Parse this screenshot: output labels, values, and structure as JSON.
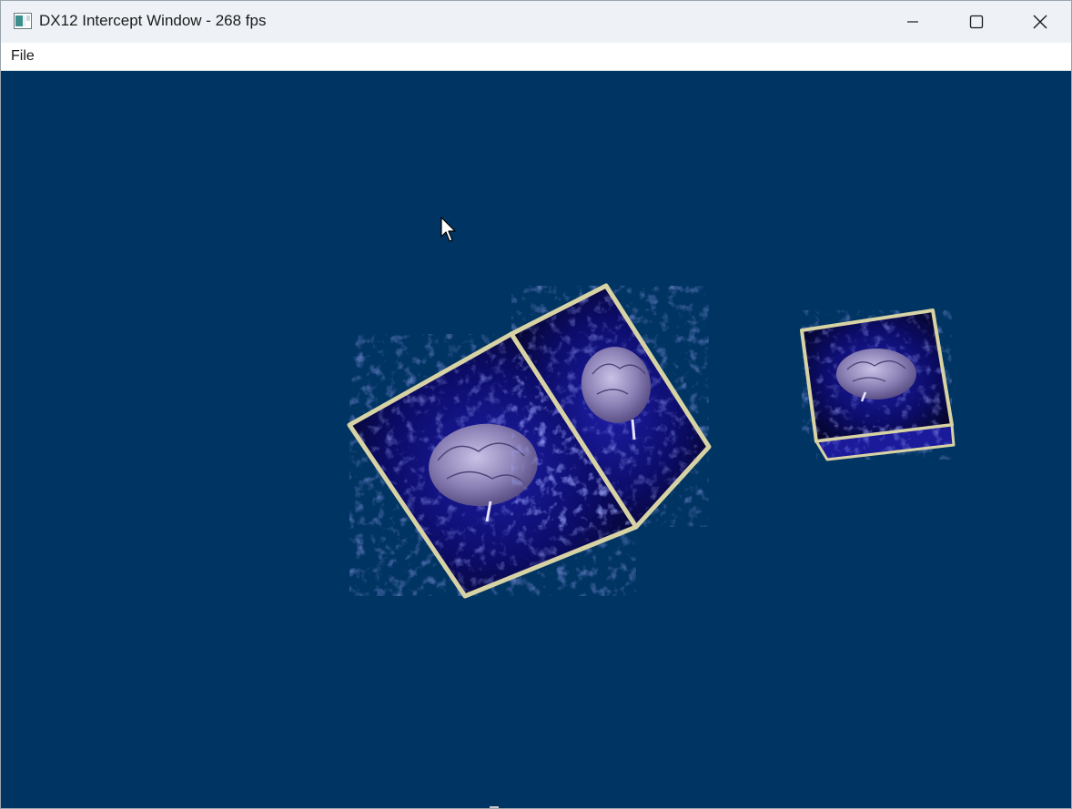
{
  "window": {
    "title": "DX12 Intercept Window - 268 fps",
    "controls": {
      "minimize_icon": "minimize-icon",
      "maximize_icon": "maximize-icon",
      "close_icon": "close-icon"
    }
  },
  "menubar": {
    "items": [
      {
        "label": "File"
      }
    ]
  },
  "viewport": {
    "background_color": "#003462",
    "scene_objects": [
      {
        "type": "textured-cube",
        "texture": "brain-on-blue-fractal"
      },
      {
        "type": "textured-cube",
        "texture": "brain-on-blue-fractal"
      }
    ]
  },
  "colors": {
    "titlebar": "#eef2f6",
    "menubar": "#ffffff",
    "cube_edge": "#d8d3a4",
    "texture_dark": "#05051e",
    "texture_blue": "#2b2bd6",
    "brain": "#8f86b8"
  }
}
